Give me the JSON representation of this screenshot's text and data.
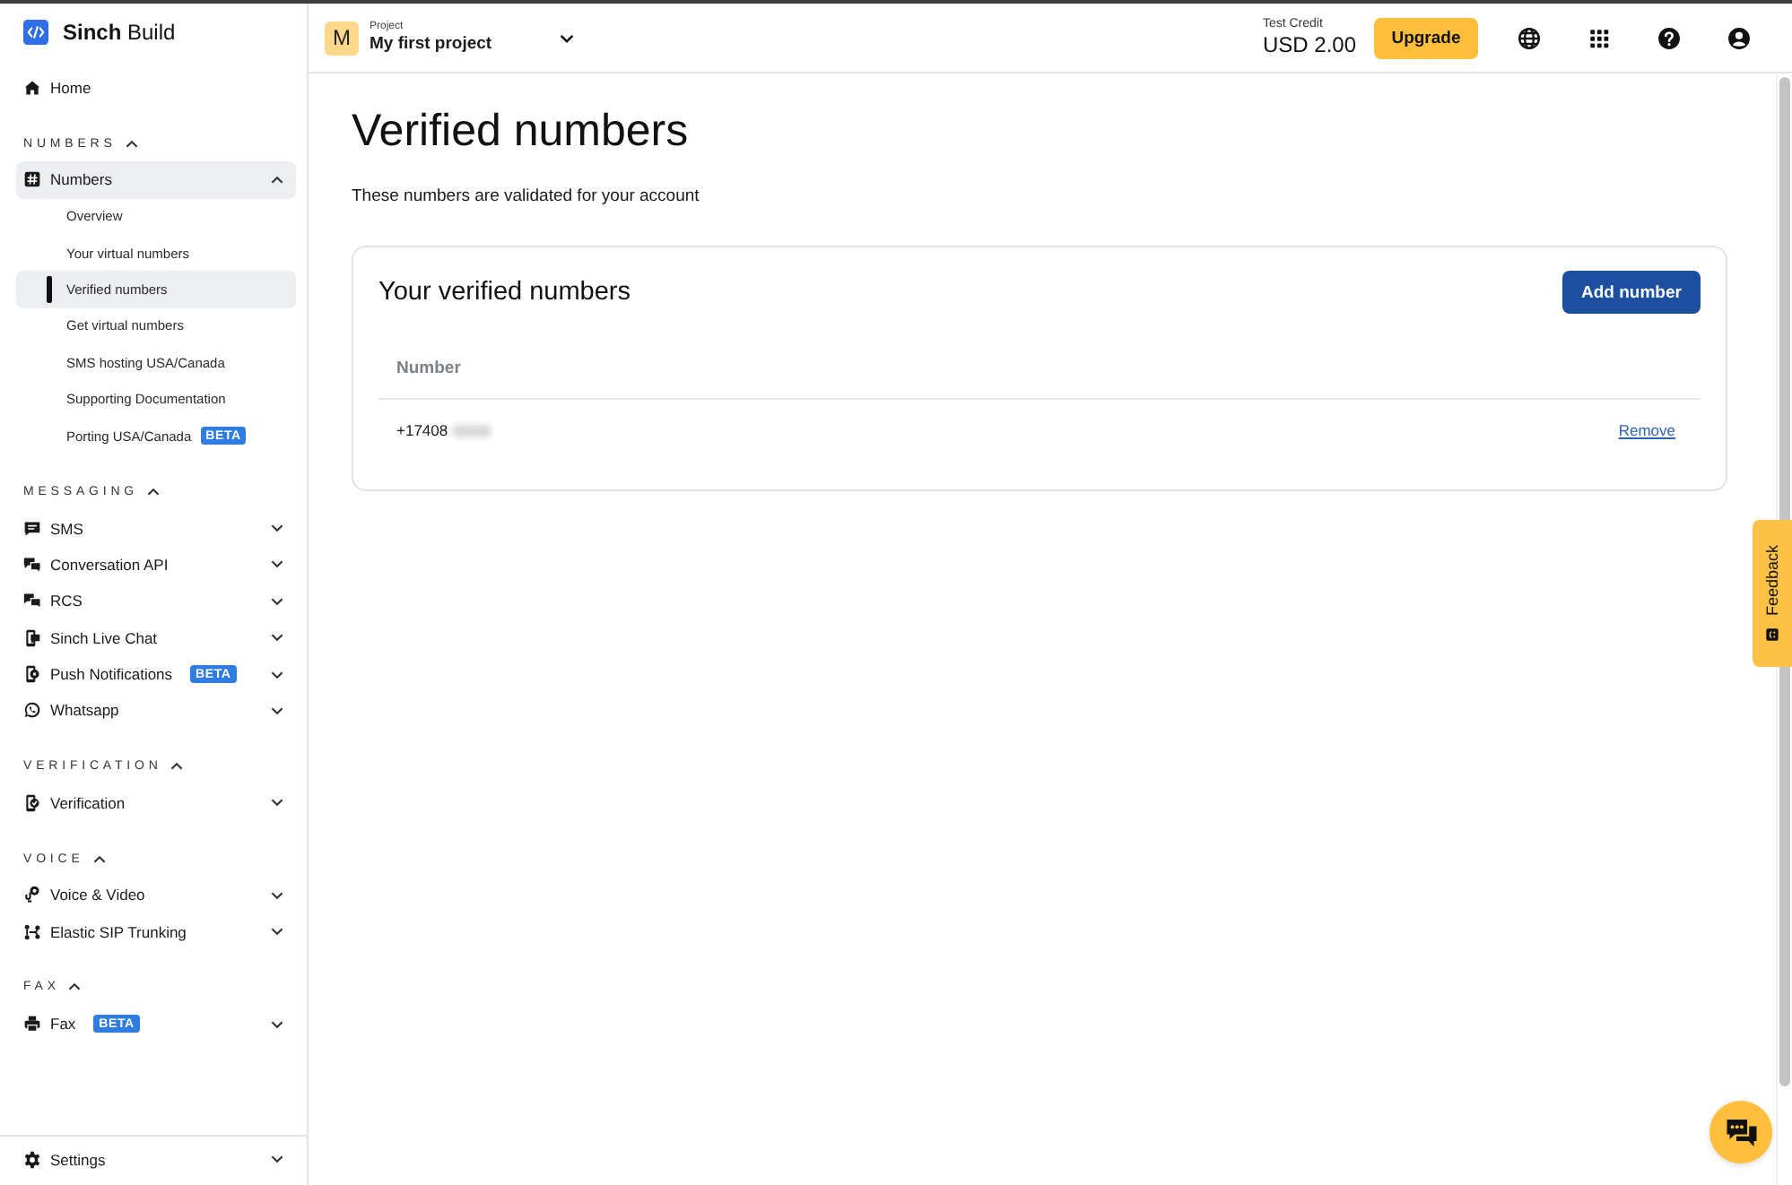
{
  "sidebar": {
    "logo": "**Sinch** Build",
    "home": {
      "label": "Home",
      "selected": false
    },
    "sections": [
      {
        "title": "NUMBERS",
        "expanded": true,
        "items": [
          {
            "label": "Numbers",
            "selected": true,
            "expanded": true,
            "children": [
              {
                "label": "Overview",
                "selected": false
              },
              {
                "label": "Your virtual numbers",
                "selected": false
              },
              {
                "label": "Verified numbers",
                "selected": true
              },
              {
                "label": "Get virtual numbers",
                "selected": false
              },
              {
                "label": "SMS hosting USA/Canada",
                "selected": false
              },
              {
                "label": "Supporting Documentation",
                "selected": false
              },
              {
                "label": "Porting USA/Canada",
                "selected": false,
                "badge": "BETA"
              }
            ]
          }
        ]
      },
      {
        "title": "MESSAGING",
        "expanded": true,
        "items": [
          {
            "label": "SMS",
            "selected": false,
            "expanded": false
          },
          {
            "label": "Conversation API",
            "selected": false,
            "expanded": false
          },
          {
            "label": "RCS",
            "selected": false,
            "expanded": false
          },
          {
            "label": "Sinch Live Chat",
            "selected": false,
            "expanded": false
          },
          {
            "label": "Push Notifications",
            "selected": false,
            "expanded": false,
            "badge": "BETA"
          },
          {
            "label": "Whatsapp",
            "selected": false,
            "expanded": false
          }
        ]
      },
      {
        "title": "VERIFICATION",
        "expanded": true,
        "items": [
          {
            "label": "Verification",
            "selected": false,
            "expanded": false
          }
        ]
      },
      {
        "title": "VOICE",
        "expanded": true,
        "items": [
          {
            "label": "Voice & Video",
            "selected": false,
            "expanded": false
          },
          {
            "label": "Elastic SIP Trunking",
            "selected": false,
            "expanded": false
          }
        ]
      },
      {
        "title": "FAX",
        "expanded": true,
        "items": [
          {
            "label": "Fax",
            "selected": false,
            "expanded": false,
            "badge": "BETA"
          }
        ]
      }
    ],
    "settings": {
      "label": "Settings",
      "selected": false,
      "expanded": false
    }
  },
  "topbar": {
    "project": {
      "avatar": "M",
      "label": "Project",
      "name": "My first project"
    },
    "credit": {
      "label": "Test Credit",
      "amount": "USD 2.00"
    },
    "upgrade_button": "Upgrade"
  },
  "main": {
    "title": "Verified numbers",
    "subtitle": "These numbers are validated for your account",
    "card": {
      "title": "Your verified numbers",
      "add_button": "Add number",
      "table": {
        "columns": [
          "Number"
        ],
        "rows": [
          {
            "number": "+17408",
            "redacted": true,
            "action": "Remove"
          }
        ]
      }
    }
  },
  "feedback_tab": {
    "label": "Feedback"
  }
}
